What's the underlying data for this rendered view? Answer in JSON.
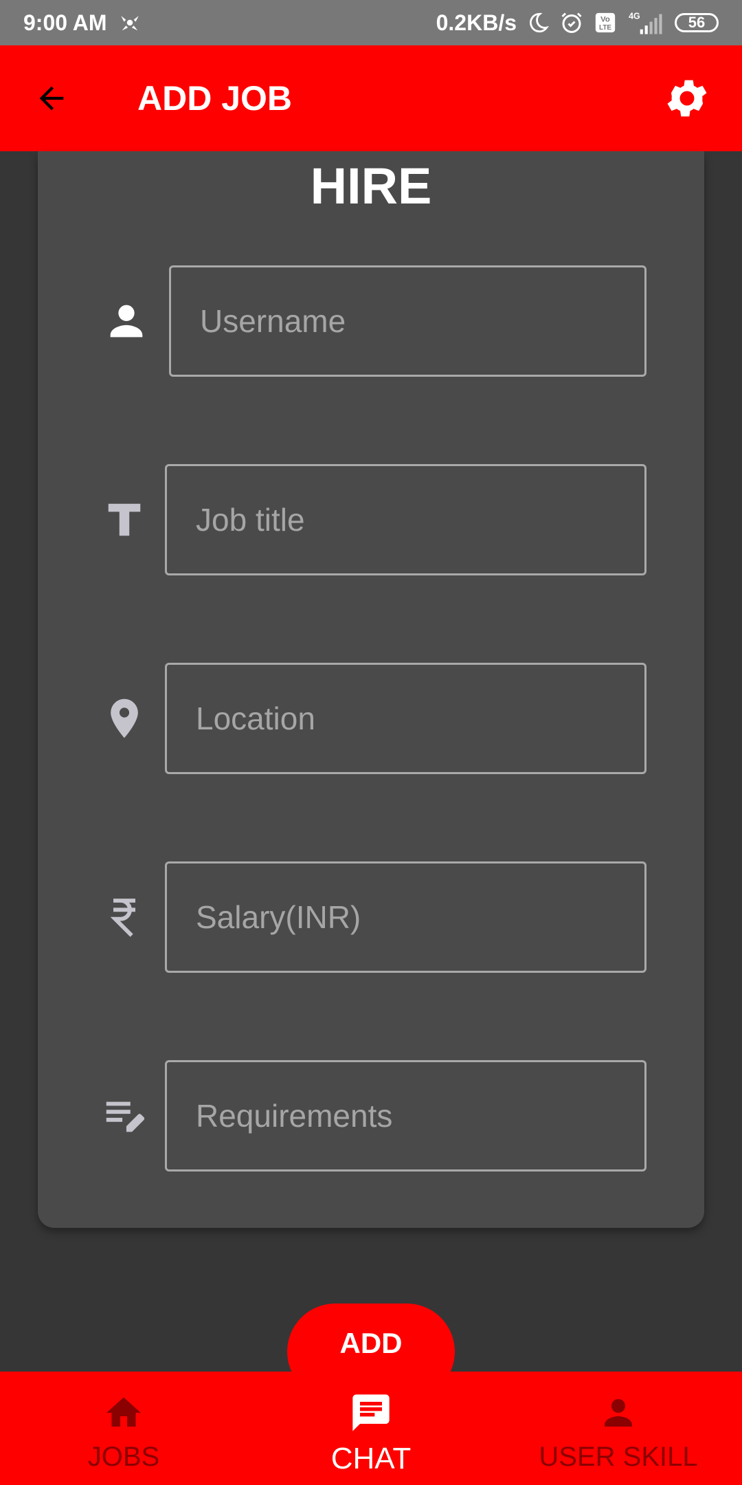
{
  "status_bar": {
    "time": "9:00 AM",
    "net_speed": "0.2KB/s",
    "volte": "Vo LTE",
    "network": "4G",
    "battery": "56",
    "icons": [
      "app-notification-icon",
      "moon-icon",
      "alarm-icon",
      "volte-icon",
      "signal-icon",
      "battery-icon"
    ]
  },
  "app_bar": {
    "title": "ADD JOB",
    "back_icon": "arrow-back-icon",
    "settings_icon": "gear-icon"
  },
  "form": {
    "heading": "HIRE",
    "fields": [
      {
        "placeholder": "Username",
        "value": "",
        "icon": "person-icon"
      },
      {
        "placeholder": "Job title",
        "value": "",
        "icon": "text-icon"
      },
      {
        "placeholder": "Location",
        "value": "",
        "icon": "location-pin-icon"
      },
      {
        "placeholder": "Salary(INR)",
        "value": "",
        "icon": "rupee-icon"
      },
      {
        "placeholder": "Requirements",
        "value": "",
        "icon": "edit-notes-icon"
      }
    ]
  },
  "add_button": {
    "label": "ADD"
  },
  "bottom_nav": {
    "items": [
      {
        "label": "JOBS",
        "icon": "home-icon",
        "active": false
      },
      {
        "label": "CHAT",
        "icon": "chat-icon",
        "active": true
      },
      {
        "label": "USER SKILL",
        "icon": "person-icon",
        "active": false
      }
    ]
  },
  "colors": {
    "primary": "#ff0000",
    "background": "#363636",
    "card": "#4a4a4a",
    "field_icon": "#c5c3cc",
    "inactive_nav": "#8b0000"
  }
}
